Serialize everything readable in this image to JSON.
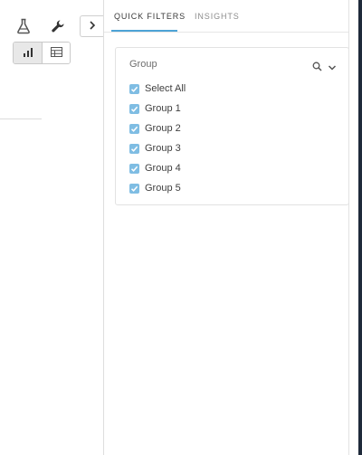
{
  "toolbar": {
    "icons": [
      "flask-icon",
      "wrench-icon",
      "chevron-right-icon",
      "bar-chart-icon",
      "table-icon"
    ],
    "active_view": "bar-chart"
  },
  "panel": {
    "tabs": [
      {
        "label": "QUICK FILTERS",
        "active": true
      },
      {
        "label": "INSIGHTS",
        "active": false
      }
    ],
    "filter": {
      "title": "Group",
      "options": [
        {
          "label": "Select All",
          "checked": true
        },
        {
          "label": "Group 1",
          "checked": true
        },
        {
          "label": "Group 2",
          "checked": true
        },
        {
          "label": "Group 3",
          "checked": true
        },
        {
          "label": "Group 4",
          "checked": true
        },
        {
          "label": "Group 5",
          "checked": true
        }
      ]
    }
  },
  "colors": {
    "accent": "#4da3d6",
    "checkbox": "#7fbde3",
    "edge_bar": "#1f2a3a"
  }
}
